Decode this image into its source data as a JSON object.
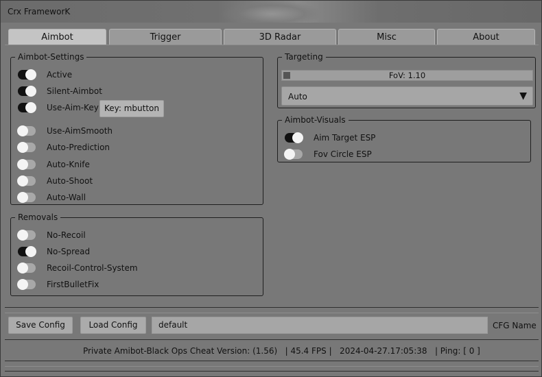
{
  "window": {
    "title": "Crx FrameworK"
  },
  "tabs": [
    {
      "label": "Aimbot",
      "active": true
    },
    {
      "label": "Trigger",
      "active": false
    },
    {
      "label": "3D Radar",
      "active": false
    },
    {
      "label": "Misc",
      "active": false
    },
    {
      "label": "About",
      "active": false
    }
  ],
  "aimbot_settings": {
    "title": "Aimbot-Settings",
    "items": [
      {
        "label": "Active",
        "on": true
      },
      {
        "label": "Silent-Aimbot",
        "on": true
      },
      {
        "label": "Use-Aim-Key",
        "on": true
      },
      {
        "label": "Use-AimSmooth",
        "on": false
      },
      {
        "label": "Auto-Prediction",
        "on": false
      },
      {
        "label": "Auto-Knife",
        "on": false
      },
      {
        "label": "Auto-Shoot",
        "on": false
      },
      {
        "label": "Auto-Wall",
        "on": false
      }
    ],
    "key_button": "Key: mbutton"
  },
  "removals": {
    "title": "Removals",
    "items": [
      {
        "label": "No-Recoil",
        "on": false
      },
      {
        "label": "No-Spread",
        "on": true
      },
      {
        "label": "Recoil-Control-System",
        "on": false
      },
      {
        "label": "FirstBulletFix",
        "on": false
      }
    ]
  },
  "targeting": {
    "title": "Targeting",
    "fov_label": "FoV: 1.10",
    "fov_fill": 0.03,
    "mode_value": "Auto",
    "dropdown_arrow": "▼"
  },
  "aimbot_visuals": {
    "title": "Aimbot-Visuals",
    "items": [
      {
        "label": "Aim Target ESP",
        "on": true
      },
      {
        "label": "Fov Circle ESP",
        "on": false
      }
    ]
  },
  "config": {
    "save_label": "Save Config",
    "load_label": "Load Config",
    "name_value": "default",
    "name_label": "CFG Name"
  },
  "status": {
    "text": "Private Amibot-Black Ops Cheat Version: (1.56)   | 45.4 FPS |   2024-04-27.17:05:38   | Ping: [ 0 ]"
  },
  "colors": {
    "window_bg": "#787878",
    "toggle_on": "#111111",
    "toggle_off": "#a8a8a8",
    "knob": "#f4f4f4"
  }
}
